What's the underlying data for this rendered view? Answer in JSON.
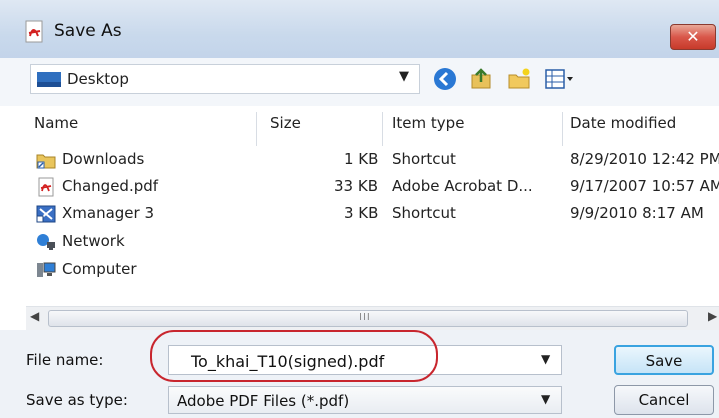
{
  "window": {
    "title": "Save As",
    "close_symbol": "✕"
  },
  "address": {
    "location": "Desktop",
    "dropdown_symbol": "▼"
  },
  "toolbar": {
    "icons": [
      "back-icon",
      "up-folder-icon",
      "new-folder-icon",
      "views-icon"
    ]
  },
  "file_list": {
    "columns": [
      "Name",
      "Size",
      "Item type",
      "Date modified"
    ],
    "rows": [
      {
        "name": "Downloads",
        "size": "1 KB",
        "type": "Shortcut",
        "date": "8/29/2010 12:42 PM",
        "icon": "shortcut-folder-icon"
      },
      {
        "name": "Changed.pdf",
        "size": "33 KB",
        "type": "Adobe Acrobat D...",
        "date": "9/17/2007 10:57 AM",
        "icon": "pdf-file-icon"
      },
      {
        "name": "Xmanager 3",
        "size": "3 KB",
        "type": "Shortcut",
        "date": "9/9/2010 8:17 AM",
        "icon": "shortcut-app-icon"
      },
      {
        "name": "Network",
        "size": "",
        "type": "",
        "date": "",
        "icon": "network-icon"
      },
      {
        "name": "Computer",
        "size": "",
        "type": "",
        "date": "",
        "icon": "computer-icon"
      }
    ]
  },
  "scrollbar": {
    "left_arrow": "◀",
    "right_arrow": "▶",
    "grip": "III"
  },
  "form": {
    "file_name_label": "File name:",
    "file_name_value": "To_khai_T10(signed).pdf",
    "save_as_type_label": "Save as type:",
    "save_as_type_value": "Adobe PDF Files (*.pdf)",
    "dropdown_symbol": "▼"
  },
  "buttons": {
    "save": "Save",
    "cancel": "Cancel"
  },
  "colors": {
    "highlight": "#c8262e",
    "title_bar": "#c9d9ec",
    "close_button": "#d9574a"
  }
}
